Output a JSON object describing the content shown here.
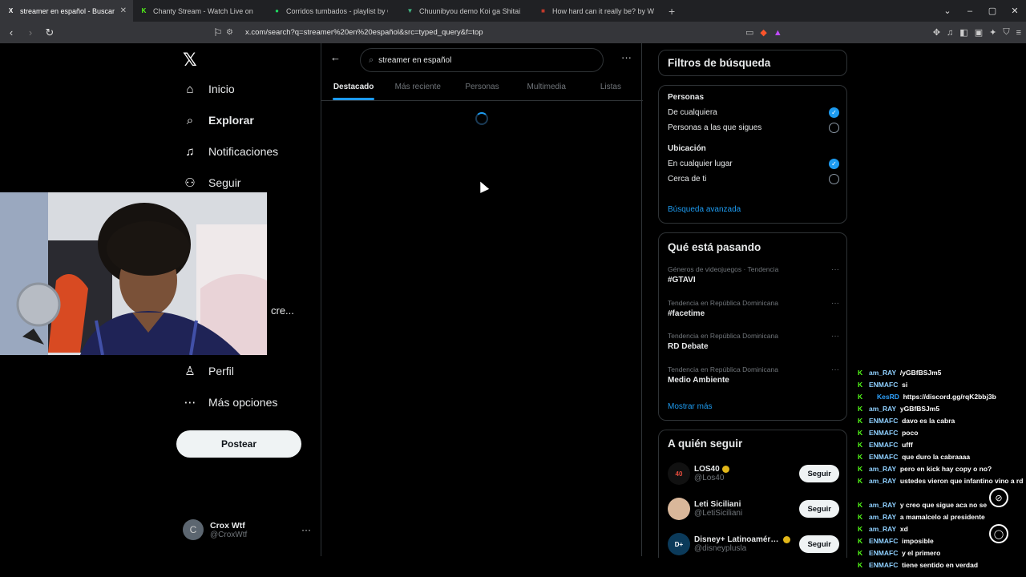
{
  "browser": {
    "tabs": [
      {
        "title": "streamer en español - Buscar / X",
        "fav": "X",
        "fav_color": "#ffffff",
        "active": true
      },
      {
        "title": "Chanty Stream - Watch Live on Kick",
        "fav": "K",
        "fav_color": "#53fc18",
        "active": false
      },
      {
        "title": "Corridos tumbados - playlist by Cristi",
        "fav": "●",
        "fav_color": "#1ed760",
        "active": false
      },
      {
        "title": "Chuunibyou demo Koi ga Shitai! Ren",
        "fav": "▼",
        "fav_color": "#41b883",
        "active": false
      },
      {
        "title": "How hard can it really be? by Waterti",
        "fav": "■",
        "fav_color": "#c0392b",
        "active": false
      }
    ],
    "new_tab": "+",
    "url": "x.com/search?q=streamer%20en%20español&src=typed_query&f=top"
  },
  "nav": {
    "items": [
      {
        "label": "Inicio",
        "icon": "home-icon",
        "glyph": "⌂",
        "bold": false
      },
      {
        "label": "Explorar",
        "icon": "search-icon",
        "glyph": "⌕",
        "bold": true
      },
      {
        "label": "Notificaciones",
        "icon": "bell-icon",
        "glyph": "♫",
        "bold": false
      },
      {
        "label": "Seguir",
        "icon": "add-user-icon",
        "glyph": "⚇",
        "bold": false
      },
      {
        "label": "Perfil",
        "icon": "profile-icon",
        "glyph": "♙",
        "bold": false
      },
      {
        "label": "Más opciones",
        "icon": "more-icon",
        "glyph": "⋯",
        "bold": false
      }
    ],
    "partial_label": "cre...",
    "post_button": "Postear",
    "account": {
      "name": "Crox Wtf",
      "handle": "@CroxWtf",
      "initial": "C"
    }
  },
  "search": {
    "query": "streamer en español",
    "tabs": [
      "Destacado",
      "Más reciente",
      "Personas",
      "Multimedia",
      "Listas"
    ],
    "active_tab": 0
  },
  "filters": {
    "title": "Filtros de búsqueda",
    "people_heading": "Personas",
    "people_options": [
      {
        "label": "De cualquiera",
        "checked": true
      },
      {
        "label": "Personas a las que sigues",
        "checked": false
      }
    ],
    "location_heading": "Ubicación",
    "location_options": [
      {
        "label": "En cualquier lugar",
        "checked": true
      },
      {
        "label": "Cerca de ti",
        "checked": false
      }
    ],
    "advanced": "Búsqueda avanzada"
  },
  "trends": {
    "title": "Qué está pasando",
    "items": [
      {
        "context": "Géneros de videojuegos · Tendencia",
        "topic": "#GTAVI"
      },
      {
        "context": "Tendencia en República Dominicana",
        "topic": "#facetime"
      },
      {
        "context": "Tendencia en República Dominicana",
        "topic": "RD Debate"
      },
      {
        "context": "Tendencia en República Dominicana",
        "topic": "Medio Ambiente"
      }
    ],
    "show_more": "Mostrar más"
  },
  "who_to_follow": {
    "title": "A quién seguir",
    "items": [
      {
        "name": "LOS40",
        "handle": "@Los40",
        "verified": true,
        "button": "Seguir",
        "avatar_text": "40",
        "avatar_bg": "#111111",
        "avatar_fg": "#e84c3d"
      },
      {
        "name": "Leti Siciliani",
        "handle": "@LetiSiciliani",
        "verified": false,
        "button": "Seguir",
        "avatar_text": "",
        "avatar_bg": "#d9b79a",
        "avatar_fg": "#ffffff"
      },
      {
        "name": "Disney+ Latinoamérica",
        "handle": "@disneyplusla",
        "verified": true,
        "button": "Seguir",
        "avatar_text": "D+",
        "avatar_bg": "#0b3a5a",
        "avatar_fg": "#ffffff"
      }
    ]
  },
  "chat": [
    {
      "user": "am_RAY",
      "text": "/yGBfBSJm5",
      "color": "#8fd0ff",
      "badge": "K",
      "indent": false
    },
    {
      "user": "ENMAFC",
      "text": "si",
      "color": "#8fd0ff",
      "badge": "K",
      "indent": false
    },
    {
      "user": "KesRD",
      "text": "https://discord.gg/rqK2bbj3b",
      "color": "#2fa3ff",
      "badge": "K",
      "indent": true
    },
    {
      "user": "am_RAY",
      "text": "yGBfBSJm5",
      "color": "#8fd0ff",
      "badge": "K",
      "indent": false
    },
    {
      "user": "ENMAFC",
      "text": "davo es la cabra",
      "color": "#8fd0ff",
      "badge": "K",
      "indent": false
    },
    {
      "user": "ENMAFC",
      "text": "poco",
      "color": "#8fd0ff",
      "badge": "K",
      "indent": false
    },
    {
      "user": "ENMAFC",
      "text": "ufff",
      "color": "#8fd0ff",
      "badge": "K",
      "indent": false
    },
    {
      "user": "ENMAFC",
      "text": "que duro la cabraaaa",
      "color": "#8fd0ff",
      "badge": "K",
      "indent": false
    },
    {
      "user": "am_RAY",
      "text": "pero en kick hay copy o no?",
      "color": "#8fd0ff",
      "badge": "K",
      "indent": false
    },
    {
      "user": "am_RAY",
      "text": "ustedes vieron que infantino vino a rd",
      "color": "#8fd0ff",
      "badge": "K",
      "indent": false
    },
    {
      "user": "am_RAY",
      "text": "y creo que sigue aca no se",
      "color": "#8fd0ff",
      "badge": "K",
      "indent": false
    },
    {
      "user": "am_RAY",
      "text": "a mamalcelo al presidente",
      "color": "#8fd0ff",
      "badge": "K",
      "indent": false
    },
    {
      "user": "am_RAY",
      "text": "xd",
      "color": "#8fd0ff",
      "badge": "K",
      "indent": false
    },
    {
      "user": "ENMAFC",
      "text": "imposible",
      "color": "#8fd0ff",
      "badge": "K",
      "indent": false
    },
    {
      "user": "ENMAFC",
      "text": "y el primero",
      "color": "#8fd0ff",
      "badge": "K",
      "indent": false
    },
    {
      "user": "ENMAFC",
      "text": "tiene sentido en verdad",
      "color": "#8fd0ff",
      "badge": "K",
      "indent": false
    }
  ],
  "colors": {
    "accent": "#1d9bf0",
    "kick_green": "#53fc18"
  }
}
